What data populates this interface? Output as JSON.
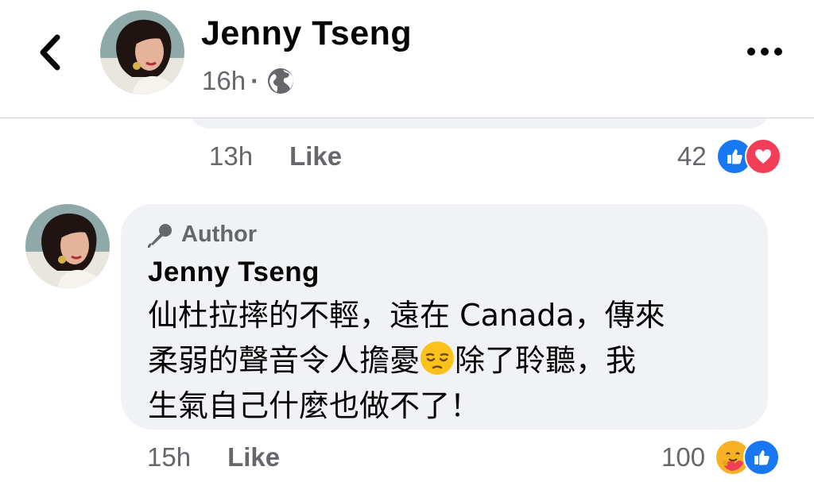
{
  "header": {
    "back_icon": "chevron-left-icon",
    "name": "Jenny  Tseng",
    "time": "16h",
    "separator": "·",
    "privacy_icon": "globe-icon",
    "more_icon": "more-horizontal-icon"
  },
  "previous_comment": {
    "time": "13h",
    "like_label": "Like",
    "reaction_count": "42",
    "reactions": [
      "like-icon",
      "love-icon"
    ]
  },
  "comment": {
    "badge_icon": "microphone-icon",
    "badge_label": "Author",
    "author": "Jenny  Tseng",
    "line1": "仙杜拉摔的不輕，遠在 Canada，傳來",
    "line2_before": "柔弱的聲音令人擔憂",
    "emoji": "pensive-face",
    "line2_after": "除了聆聽，我",
    "line3": "生氣自己什麼也做不了！",
    "time": "15h",
    "like_label": "Like",
    "reaction_count": "100",
    "reactions": [
      "care-icon",
      "like-icon"
    ]
  },
  "colors": {
    "facebook_blue": "#1877f2",
    "love_red": "#f33e58",
    "care_yellow": "#f7b125",
    "bubble_gray": "#f0f2f5",
    "secondary_text": "#65676b"
  }
}
